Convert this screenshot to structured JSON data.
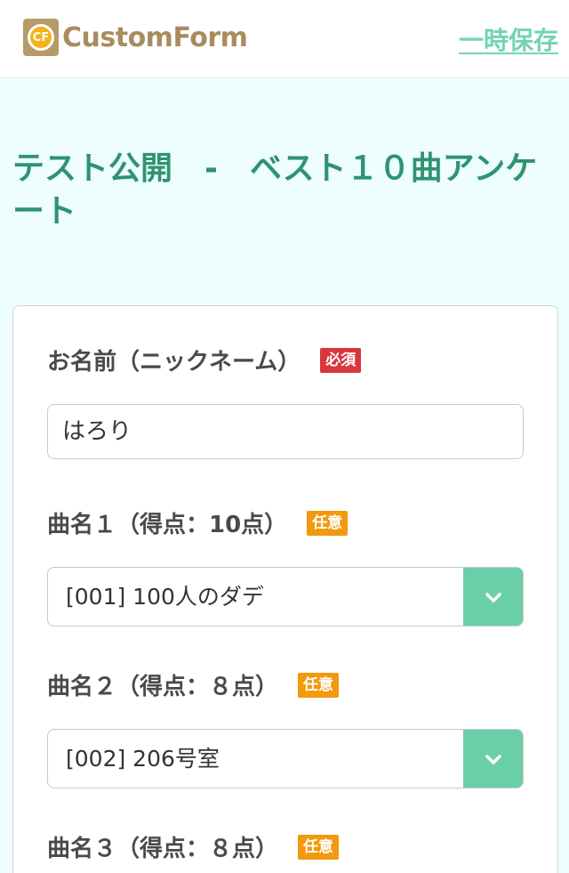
{
  "header": {
    "logo_mark": "CF",
    "logo_text": "CustomForm",
    "save_label": "一時保存"
  },
  "page": {
    "title": "テスト公開　-　ベスト１０曲アンケート"
  },
  "form": {
    "name_field": {
      "label": "お名前（ニックネーム）",
      "badge": "必須",
      "value": "はろり"
    },
    "song1": {
      "label": "曲名１（得点：10点）",
      "badge": "任意",
      "selected": "[001] 100人のダデ"
    },
    "song2": {
      "label": "曲名２（得点：８点）",
      "badge": "任意",
      "selected": "[002] 206号室"
    },
    "song3": {
      "label": "曲名３（得点：８点）",
      "badge": "任意"
    }
  },
  "colors": {
    "accent": "#6acfa8",
    "title": "#2e9470",
    "required": "#d9363e",
    "optional": "#f2990e",
    "background": "#eefdfd"
  },
  "icons": {
    "dropdown": "chevron-down-icon"
  }
}
